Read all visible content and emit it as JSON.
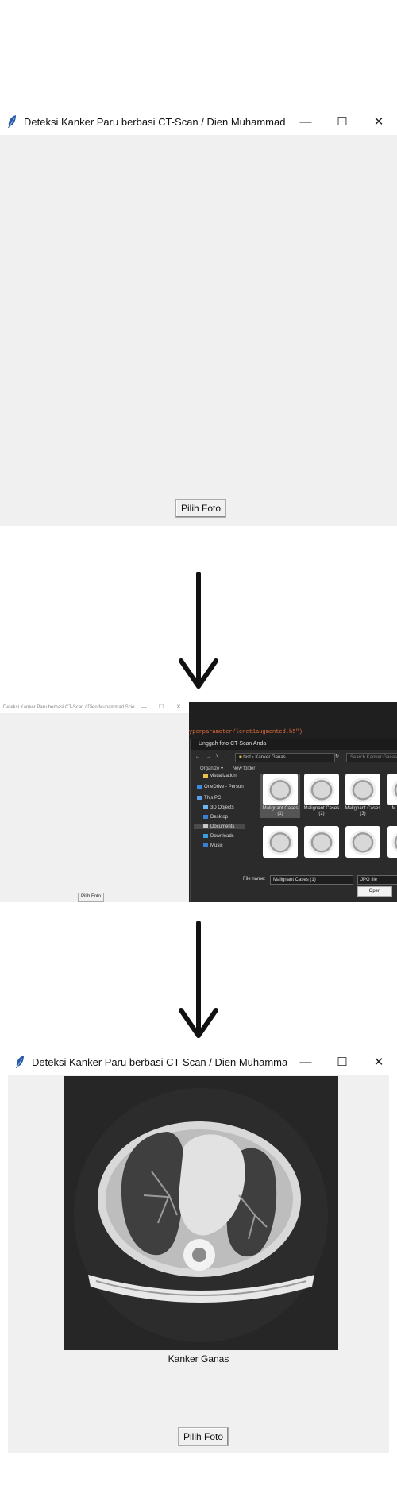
{
  "window1": {
    "title": "Deteksi Kanker Paru berbasi CT-Scan / Dien Muhammad Scie...",
    "button_label": "Pilih Foto"
  },
  "middle": {
    "mini_title": "Deteksi Kanker Paru berbasi CT-Scan / Dien Muhammad Scie...",
    "mini_button": "Pilih Foto",
    "code_line": "yperparameter/lenet1augmented.h5\")",
    "dialog": {
      "title": "Unggah foto CT-Scan Anda",
      "path": [
        "test",
        "Kanker Ganas"
      ],
      "search_placeholder": "Search Kanker Ganas",
      "organize": "Organize ▾",
      "new_folder": "New folder",
      "nav_items": [
        "visualization",
        "OneDrive - Person",
        "This PC",
        "3D Objects",
        "Desktop",
        "Documents",
        "Downloads",
        "Music"
      ],
      "thumbs": [
        "Malignant Cases (1)",
        "Malignant Cases (2)",
        "Malignant Cases (3)",
        "M",
        "",
        "",
        "",
        ""
      ],
      "file_name_label": "File name:",
      "file_name_value": "Malignant Cases (1)",
      "file_type": "JPG file",
      "open_button": "Open"
    }
  },
  "window2": {
    "title": "Deteksi Kanker Paru berbasi CT-Scan / Dien Muhammad Scie...",
    "result_label": "Kanker Ganas",
    "button_label": "Pilih Foto"
  },
  "icons": {
    "app": "feather-icon",
    "minimize": "minimize-icon",
    "maximize": "maximize-icon",
    "close": "close-icon",
    "flow": "arrow-down-icon"
  },
  "colors": {
    "tk_background": "#f0f0f0",
    "dialog_background": "#2b2b2b",
    "code_accent": "#e06c3c"
  }
}
